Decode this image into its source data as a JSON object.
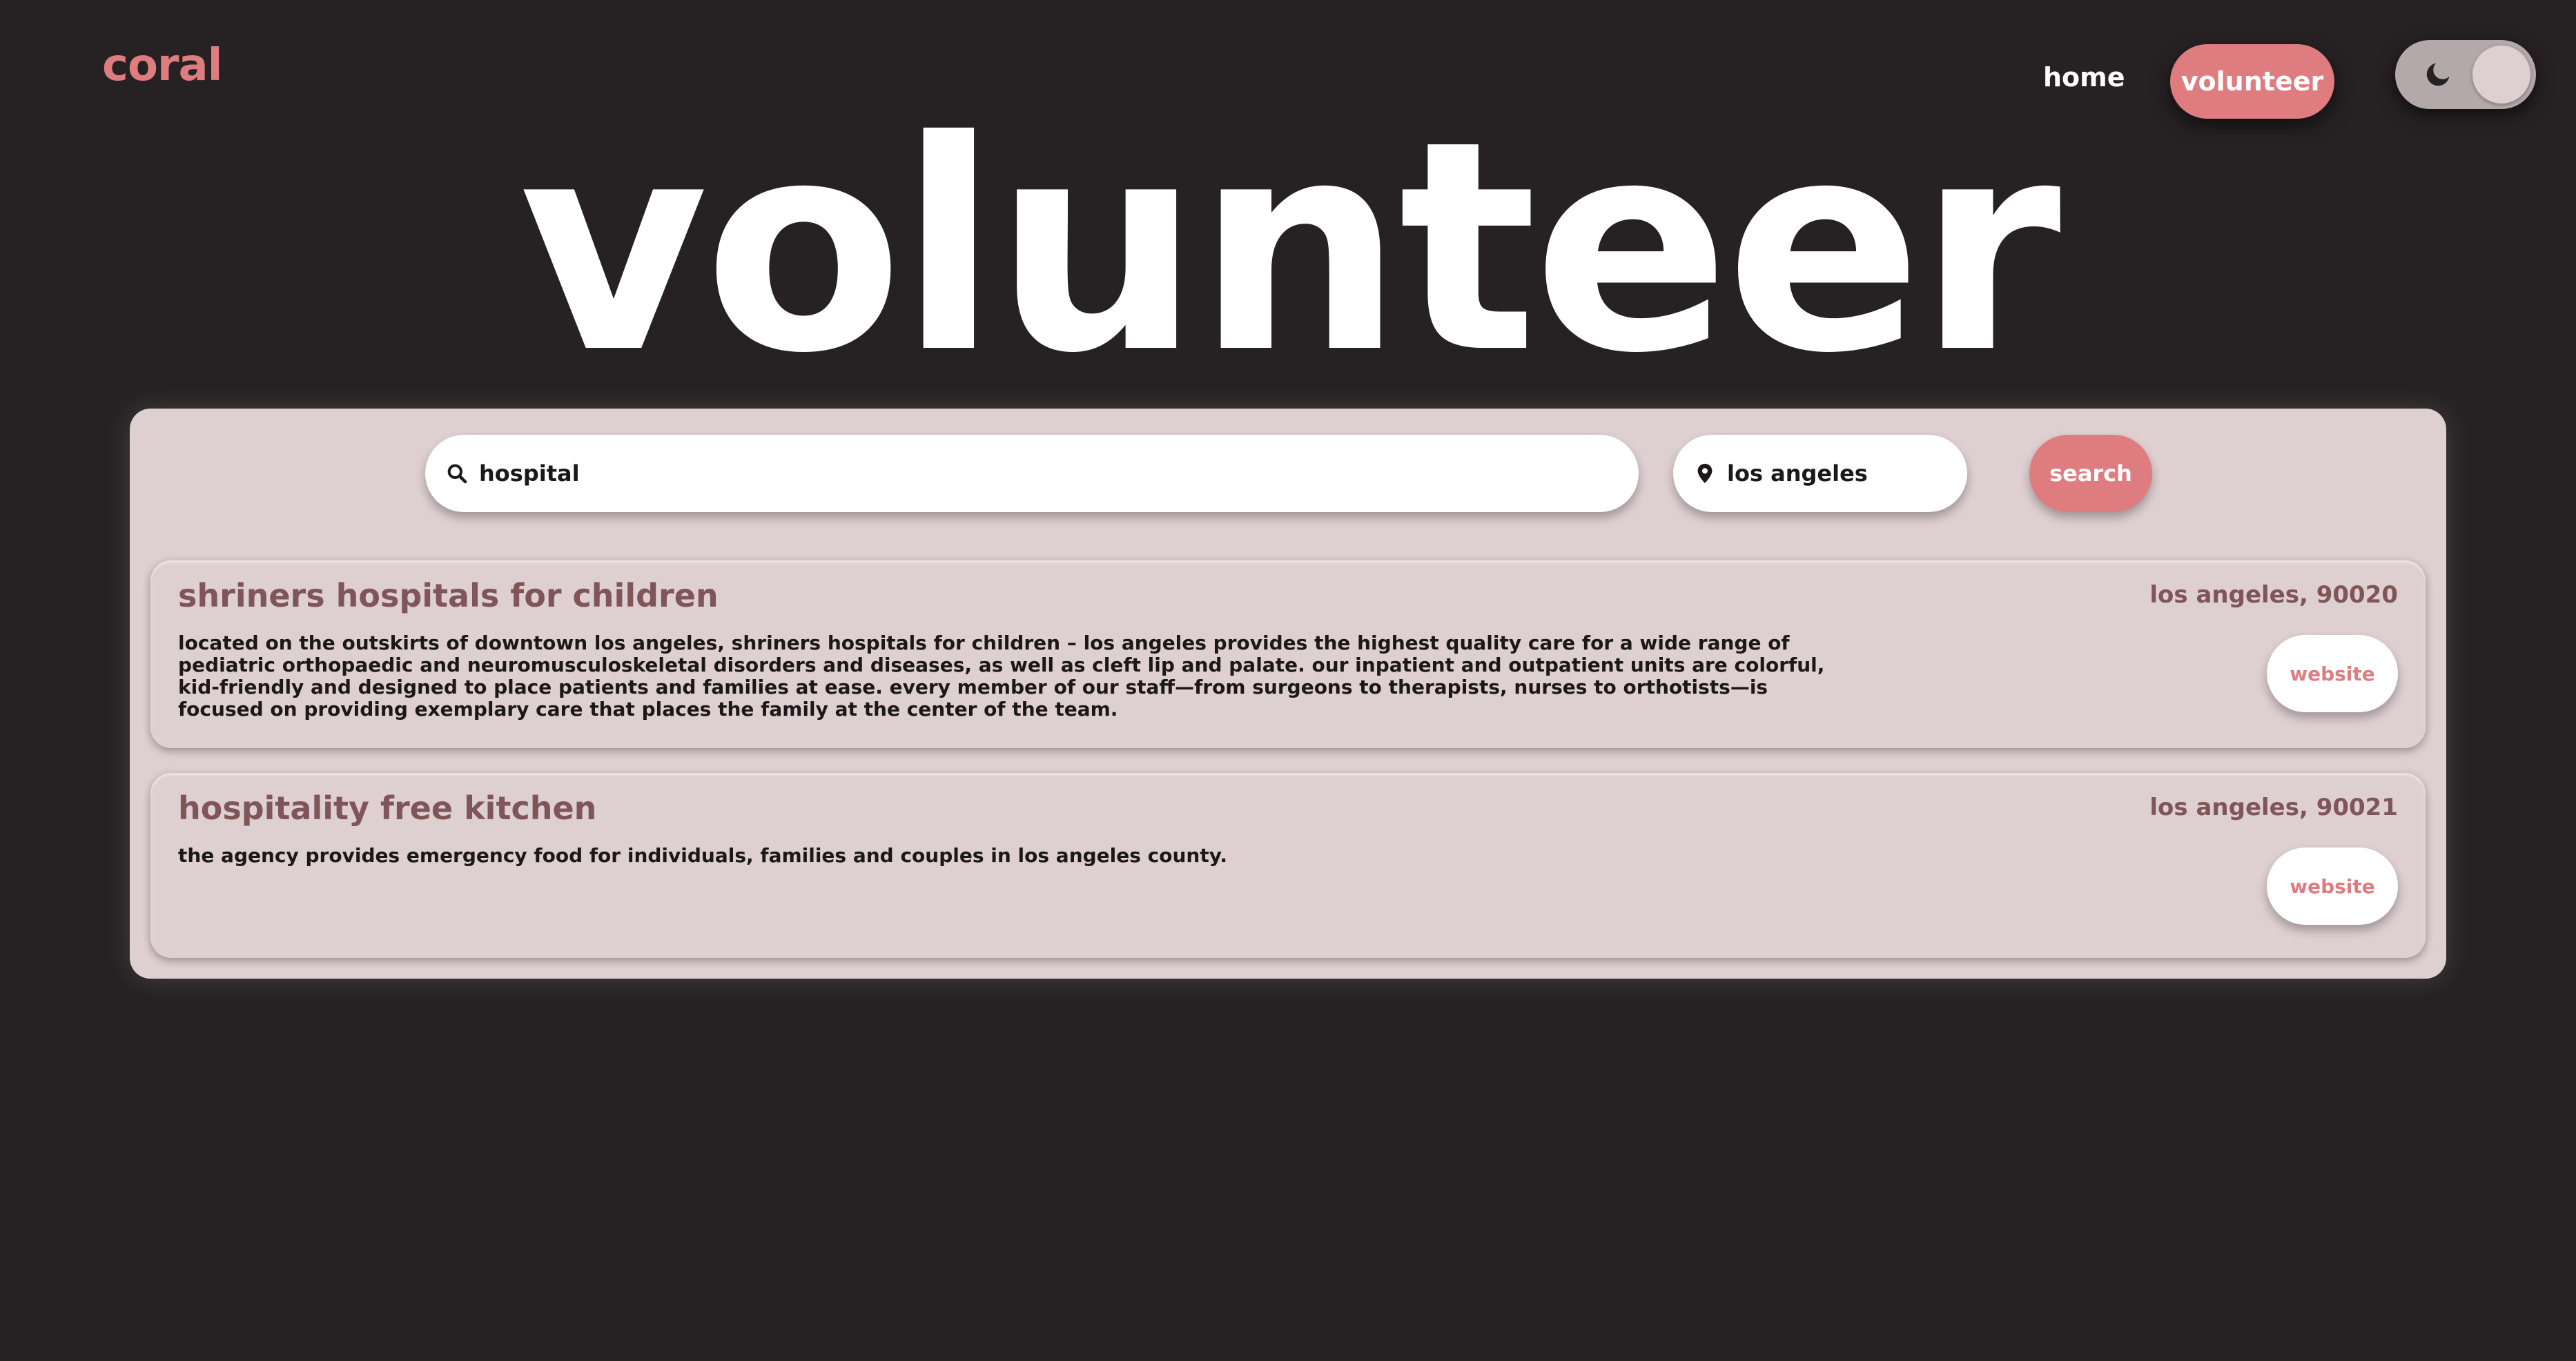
{
  "brand": {
    "logo": "coral"
  },
  "nav": {
    "home_label": "home",
    "volunteer_label": "volunteer",
    "theme_toggle": {
      "icon": "moon-icon",
      "state": "dark"
    }
  },
  "hero": {
    "title": "volunteer"
  },
  "search": {
    "query_value": "hospital",
    "query_icon": "search-icon",
    "location_value": "los angeles",
    "location_icon": "map-pin-icon",
    "button_label": "search"
  },
  "results": [
    {
      "name": "shriners hospitals for children",
      "location": "los angeles, 90020",
      "description": "located on the outskirts of downtown los angeles, shriners hospitals for children – los angeles provides the highest quality care for a wide range of pediatric orthopaedic and neuromusculoskeletal disorders and diseases, as well as cleft lip and palate. our inpatient and outpatient units are colorful, kid-friendly and designed to place patients and families at ease. every member of our staff—from surgeons to therapists, nurses to orthotists—is focused on providing exemplary care that places the family at the center of the team.",
      "website_label": "website"
    },
    {
      "name": "hospitality free kitchen",
      "location": "los angeles, 90021",
      "description": "the agency provides emergency food for individuals, families and couples in los angeles county.",
      "website_label": "website"
    }
  ],
  "colors": {
    "background": "#262122",
    "accent": "#de7c7f",
    "panel": "#decfd1",
    "card_title": "#7f5558"
  }
}
